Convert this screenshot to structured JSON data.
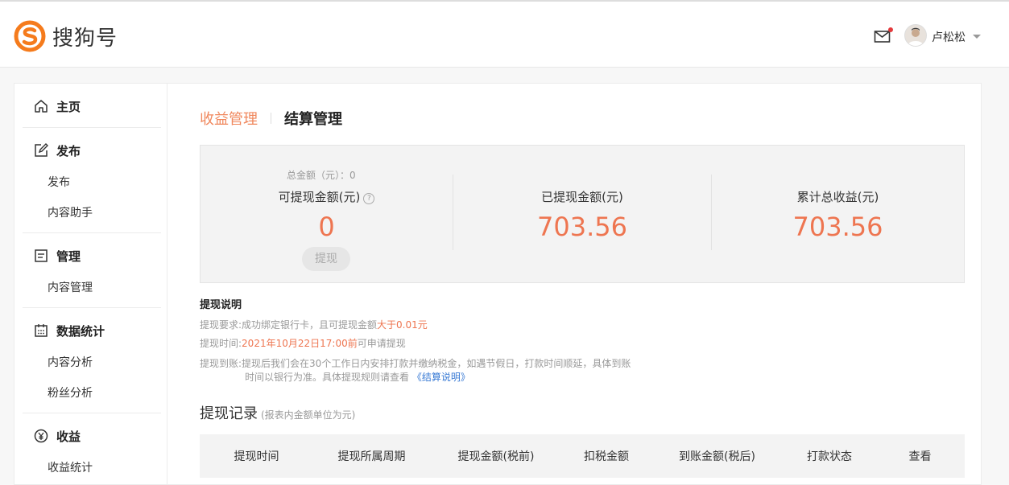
{
  "header": {
    "logo_text": "搜狗号",
    "user_name": "卢松松",
    "colors": {
      "brand": "#f57b1c",
      "accent": "#ee7550"
    }
  },
  "sidebar": {
    "groups": [
      {
        "label": "主页",
        "icon": "home-icon",
        "items": []
      },
      {
        "label": "发布",
        "icon": "edit-icon",
        "items": [
          "发布",
          "内容助手"
        ]
      },
      {
        "label": "管理",
        "icon": "document-icon",
        "items": [
          "内容管理"
        ]
      },
      {
        "label": "数据统计",
        "icon": "calendar-icon",
        "items": [
          "内容分析",
          "粉丝分析"
        ]
      },
      {
        "label": "收益",
        "icon": "yen-icon",
        "items": [
          "收益统计"
        ]
      }
    ]
  },
  "tabs": {
    "active": "收益管理",
    "other": "结算管理"
  },
  "stats": {
    "total": "总金额（元）：0",
    "withdrawable_label": "可提现金额(元)",
    "withdrawable_value": "0",
    "withdraw_button": "提现",
    "withdrawn_label": "已提现金额(元)",
    "withdrawn_value": "703.56",
    "cumulative_label": "累计总收益(元)",
    "cumulative_value": "703.56"
  },
  "notes": {
    "title": "提现说明",
    "req_prefix": "提现要求:成功绑定银行卡，且可提现金额",
    "req_highlight": "大于0.01元",
    "time_prefix": "提现时间:",
    "time_highlight": "2021年10月22日17:00前",
    "time_suffix": "可申请提现",
    "arrival_line1": "提现到账:提现后我们会在30个工作日内安排打款并缴纳税金，如遇节假日，打款时间顺延，具体到账",
    "arrival_line2": "时间以银行为准。具体提现规则请查看",
    "arrival_link": "《结算说明》"
  },
  "records": {
    "title": "提现记录",
    "subtitle": "(报表内金额单位为元)",
    "columns": [
      "提现时间",
      "提现所属周期",
      "提现金额(税前)",
      "扣税金额",
      "到账金额(税后)",
      "打款状态",
      "查看"
    ]
  }
}
